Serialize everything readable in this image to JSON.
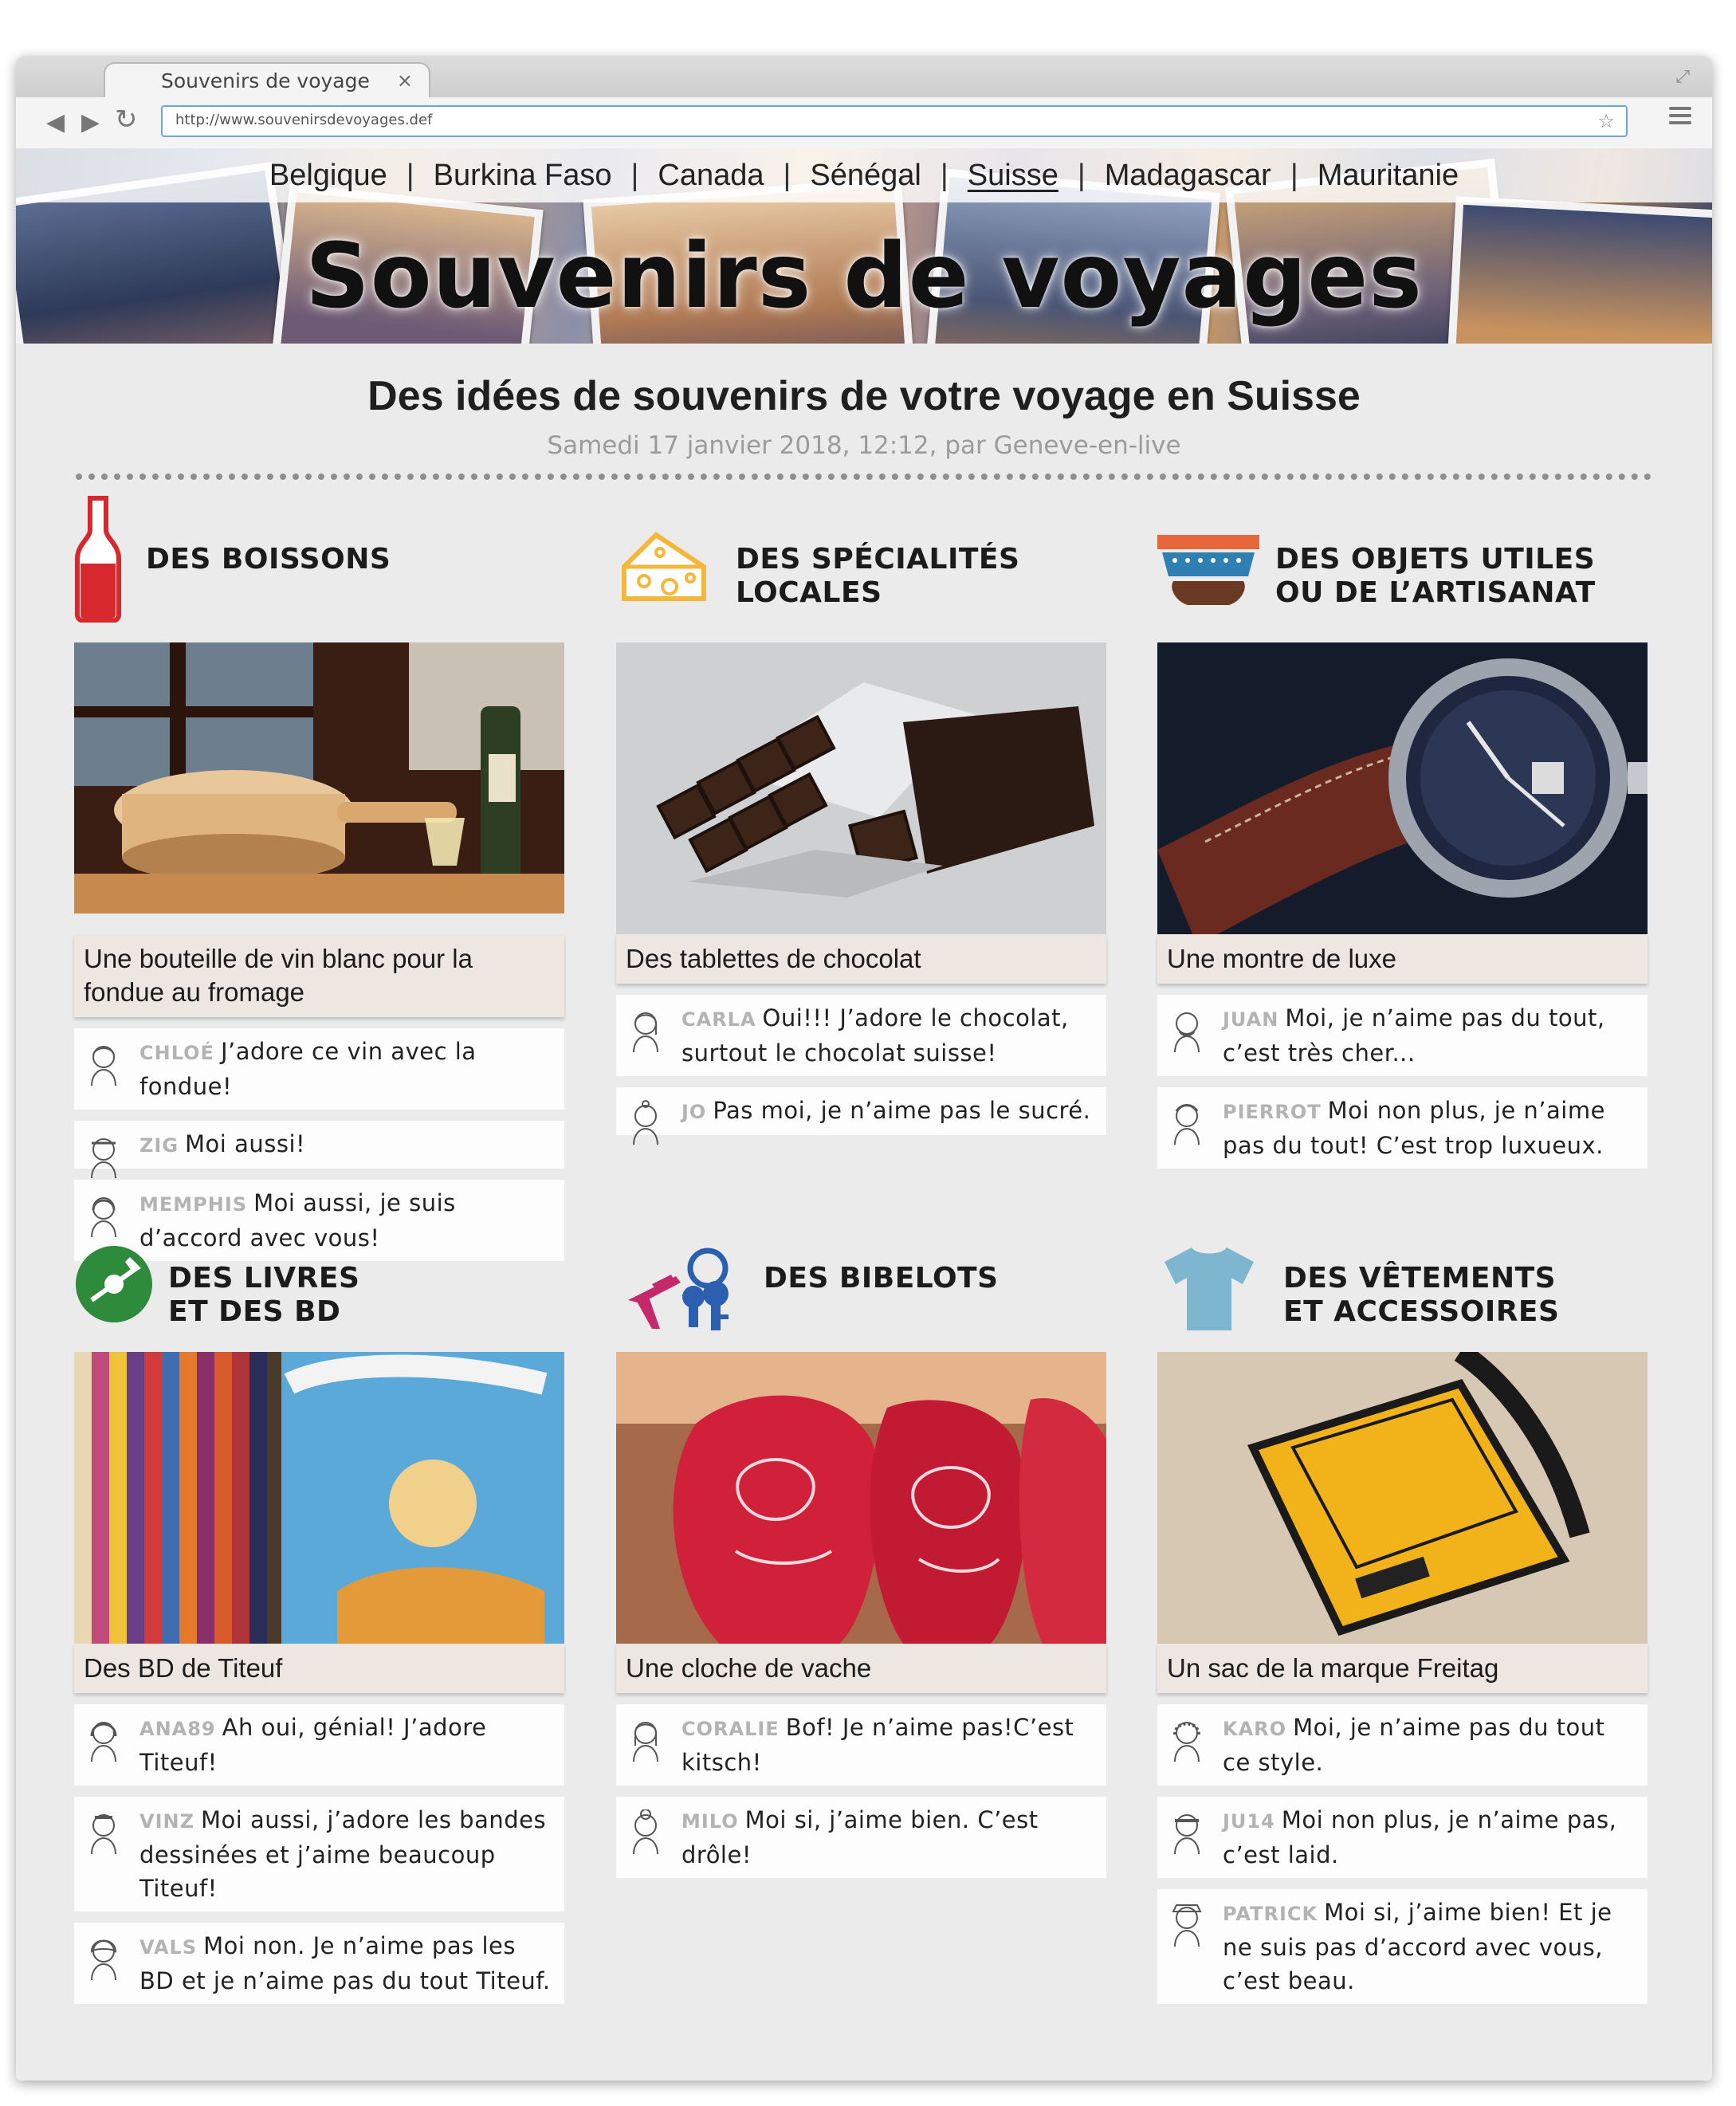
{
  "browser": {
    "tab_title": "Souvenirs de voyage",
    "tab_close": "×",
    "url": "http://www.souvenirsdevoyages.def",
    "back": "◀",
    "forward": "▶",
    "reload": "↻",
    "star": "☆",
    "resize": "⤢"
  },
  "nav": {
    "items": [
      "Belgique",
      "Burkina Faso",
      "Canada",
      "Sénégal",
      "Suisse",
      "Madagascar",
      "Mauritanie"
    ],
    "active": "Suisse",
    "separator": "|"
  },
  "site_title": "Souvenirs de voyages",
  "article": {
    "title": "Des idées de souvenirs de votre voyage en Suisse",
    "byline": "Samedi 17 janvier 2018, 12:12, par Geneve-en-live"
  },
  "sections": [
    {
      "title_lines": [
        "DES BOISSONS",
        ""
      ],
      "icon": "bottle-icon",
      "caption": "Une bouteille de vin blanc pour la fondue au fromage",
      "comments": [
        {
          "user": "CHLOÉ",
          "text": "J’adore ce vin avec la fondue!"
        },
        {
          "user": "ZIG",
          "text": "Moi aussi!"
        },
        {
          "user": "MEMPHIS",
          "text": "Moi aussi, je suis d’accord avec vous!"
        }
      ]
    },
    {
      "title_lines": [
        "DES SPÉCIALITÉS",
        "LOCALES"
      ],
      "icon": "cheese-icon",
      "caption": "Des tablettes de chocolat",
      "comments": [
        {
          "user": "CARLA",
          "text": "Oui!!! J’adore le chocolat, surtout le chocolat suisse!"
        },
        {
          "user": "JO",
          "text": "Pas moi, je n’aime pas le sucré."
        }
      ]
    },
    {
      "title_lines": [
        "DES OBJETS UTILES",
        "OU DE L’ARTISANAT"
      ],
      "icon": "craft-pottery-icon",
      "caption": "Une montre de luxe",
      "comments": [
        {
          "user": "JUAN",
          "text": "Moi, je n’aime pas du tout, c’est très cher..."
        },
        {
          "user": "PIERROT",
          "text": "Moi non plus, je n’aime pas du tout! C’est trop luxueux."
        }
      ]
    },
    {
      "title_lines": [
        "DES LIVRES",
        "ET DES BD"
      ],
      "icon": "book-disc-icon",
      "caption": "Des BD de Titeuf",
      "comments": [
        {
          "user": "ANA89",
          "text": "Ah oui, génial! J’adore Titeuf!"
        },
        {
          "user": "VINZ",
          "text": "Moi aussi, j’adore les bandes dessinées et j’aime beaucoup Titeuf!"
        },
        {
          "user": "VALS",
          "text": "Moi non. Je n’aime pas les BD et je n’aime pas du tout Titeuf."
        }
      ]
    },
    {
      "title_lines": [
        "DES BIBELOTS",
        ""
      ],
      "icon": "keychain-eiffel-icon",
      "caption": "Une cloche de vache",
      "comments": [
        {
          "user": "CORALIE",
          "text": "Bof! Je n’aime pas!C’est kitsch!"
        },
        {
          "user": "MILO",
          "text": "Moi si, j’aime bien. C’est drôle!"
        }
      ]
    },
    {
      "title_lines": [
        "DES VÊTEMENTS",
        "ET ACCESSOIRES"
      ],
      "icon": "tshirt-icon",
      "caption": "Un sac de la marque Freitag",
      "comments": [
        {
          "user": "KARO",
          "text": "Moi, je n’aime pas du tout ce style."
        },
        {
          "user": "JU14",
          "text": "Moi non plus, je n’aime pas, c’est laid."
        },
        {
          "user": "PATRICK",
          "text": "Moi si, j’aime bien! Et je ne suis pas d’accord avec vous, c’est beau."
        }
      ]
    }
  ],
  "colors": {
    "bottle": "#d6282d",
    "cheese": "#f4b73a",
    "craft_blue": "#2f7fb3",
    "craft_orange": "#e8673a",
    "craft_brown": "#6b3a24",
    "books": "#2e8b3c",
    "keys_blue": "#2b5fb0",
    "eiffel": "#c42a6b",
    "tshirt": "#7fb6cf"
  }
}
